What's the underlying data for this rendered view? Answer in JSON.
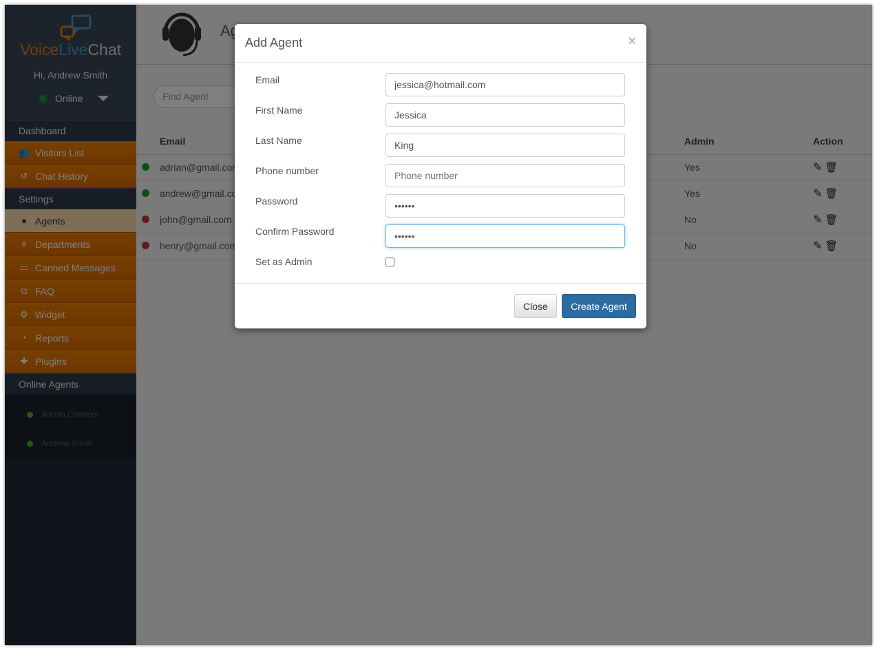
{
  "sidebar": {
    "logo": {
      "voice": "Voice",
      "live": "Live",
      "chat": "Chat"
    },
    "greeting": "Hi, Andrew Smith",
    "status": "Online",
    "sections": {
      "dashboard": "Dashboard",
      "settings": "Settings",
      "online_agents": "Online Agents"
    },
    "dashboard_items": [
      {
        "label": "Visitors List",
        "icon": "users-icon"
      },
      {
        "label": "Chat History",
        "icon": "history-icon"
      }
    ],
    "settings_items": [
      {
        "label": "Agents",
        "icon": "agent-icon"
      },
      {
        "label": "Departments",
        "icon": "departments-icon"
      },
      {
        "label": "Canned Messages",
        "icon": "comment-icon"
      },
      {
        "label": "FAQ",
        "icon": "faq-icon"
      },
      {
        "label": "Widget",
        "icon": "gear-icon"
      },
      {
        "label": "Reports",
        "icon": "pie-chart-icon"
      },
      {
        "label": "Plugins",
        "icon": "puzzle-icon"
      }
    ],
    "online_agents": [
      "Adrian Connors",
      "Andrew Smith"
    ]
  },
  "header": {
    "title": "Agents"
  },
  "search": {
    "placeholder": "Find Agent"
  },
  "table": {
    "columns": {
      "email": "Email",
      "admin": "Admin",
      "action": "Action"
    },
    "rows": [
      {
        "email": "adrian@gmail.com",
        "admin": "Yes",
        "online": true
      },
      {
        "email": "andrew@gmail.com",
        "admin": "Yes",
        "online": true
      },
      {
        "email": "john@gmail.com",
        "admin": "No",
        "online": false
      },
      {
        "email": "henry@gmail.com",
        "admin": "No",
        "online": false
      }
    ]
  },
  "modal": {
    "title": "Add Agent",
    "close_x": "×",
    "fields": {
      "email": {
        "label": "Email",
        "value": "jessica@hotmail.com"
      },
      "first_name": {
        "label": "First Name",
        "value": "Jessica"
      },
      "last_name": {
        "label": "Last Name",
        "value": "King"
      },
      "phone": {
        "label": "Phone number",
        "value": "",
        "placeholder": "Phone number"
      },
      "password": {
        "label": "Password",
        "value": "123456"
      },
      "confirm_password": {
        "label": "Confirm Password",
        "value": "123456"
      },
      "admin": {
        "label": "Set as Admin",
        "checked": false
      }
    },
    "close_label": "Close",
    "create_label": "Create Agent"
  },
  "colors": {
    "online": "#1a9a3a",
    "offline": "#c0393b",
    "accent": "#f08000",
    "primary": "#2d6ca2"
  }
}
